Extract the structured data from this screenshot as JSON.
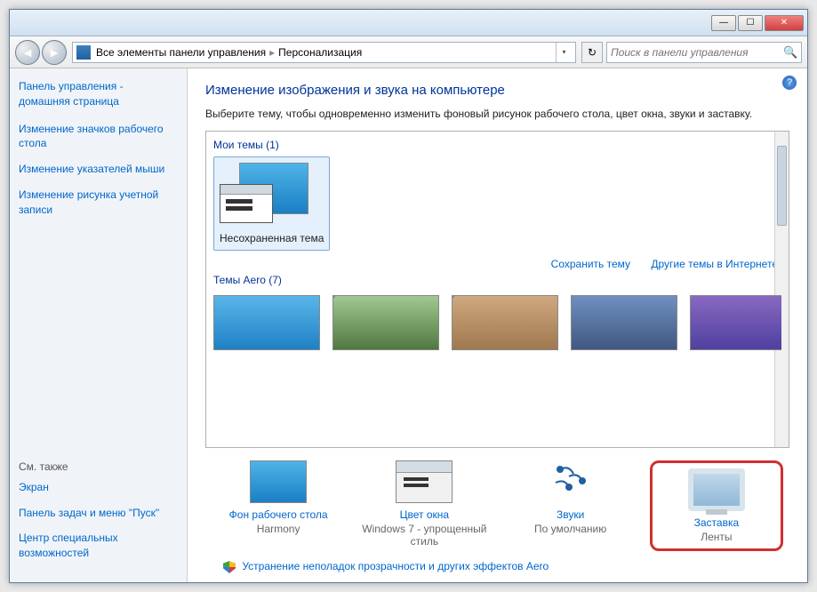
{
  "breadcrumb": {
    "item1": "Все элементы панели управления",
    "item2": "Персонализация"
  },
  "search": {
    "placeholder": "Поиск в панели управления"
  },
  "sidebar": {
    "home1": "Панель управления -",
    "home2": "домашняя страница",
    "links": [
      "Изменение значков рабочего стола",
      "Изменение указателей мыши",
      "Изменение рисунка учетной записи"
    ],
    "seealso": "См. также",
    "bottom": [
      "Экран",
      "Панель задач и меню \"Пуск\"",
      "Центр специальных возможностей"
    ]
  },
  "content": {
    "title": "Изменение изображения и звука на компьютере",
    "desc": "Выберите тему, чтобы одновременно изменить фоновый рисунок рабочего стола, цвет окна, звуки и заставку.",
    "mythemes_label": "Мои темы (1)",
    "theme_name": "Несохраненная тема",
    "save_theme": "Сохранить тему",
    "other_themes": "Другие темы в Интернете",
    "aero_label": "Темы Aero (7)"
  },
  "bottom": {
    "wallpaper": {
      "label": "Фон рабочего стола",
      "value": "Harmony"
    },
    "color": {
      "label": "Цвет окна",
      "value": "Windows 7 - упрощенный стиль"
    },
    "sounds": {
      "label": "Звуки",
      "value": "По умолчанию"
    },
    "saver": {
      "label": "Заставка",
      "value": "Ленты"
    }
  },
  "footer": {
    "aero_troubleshoot": "Устранение неполадок прозрачности и других эффектов Aero"
  }
}
